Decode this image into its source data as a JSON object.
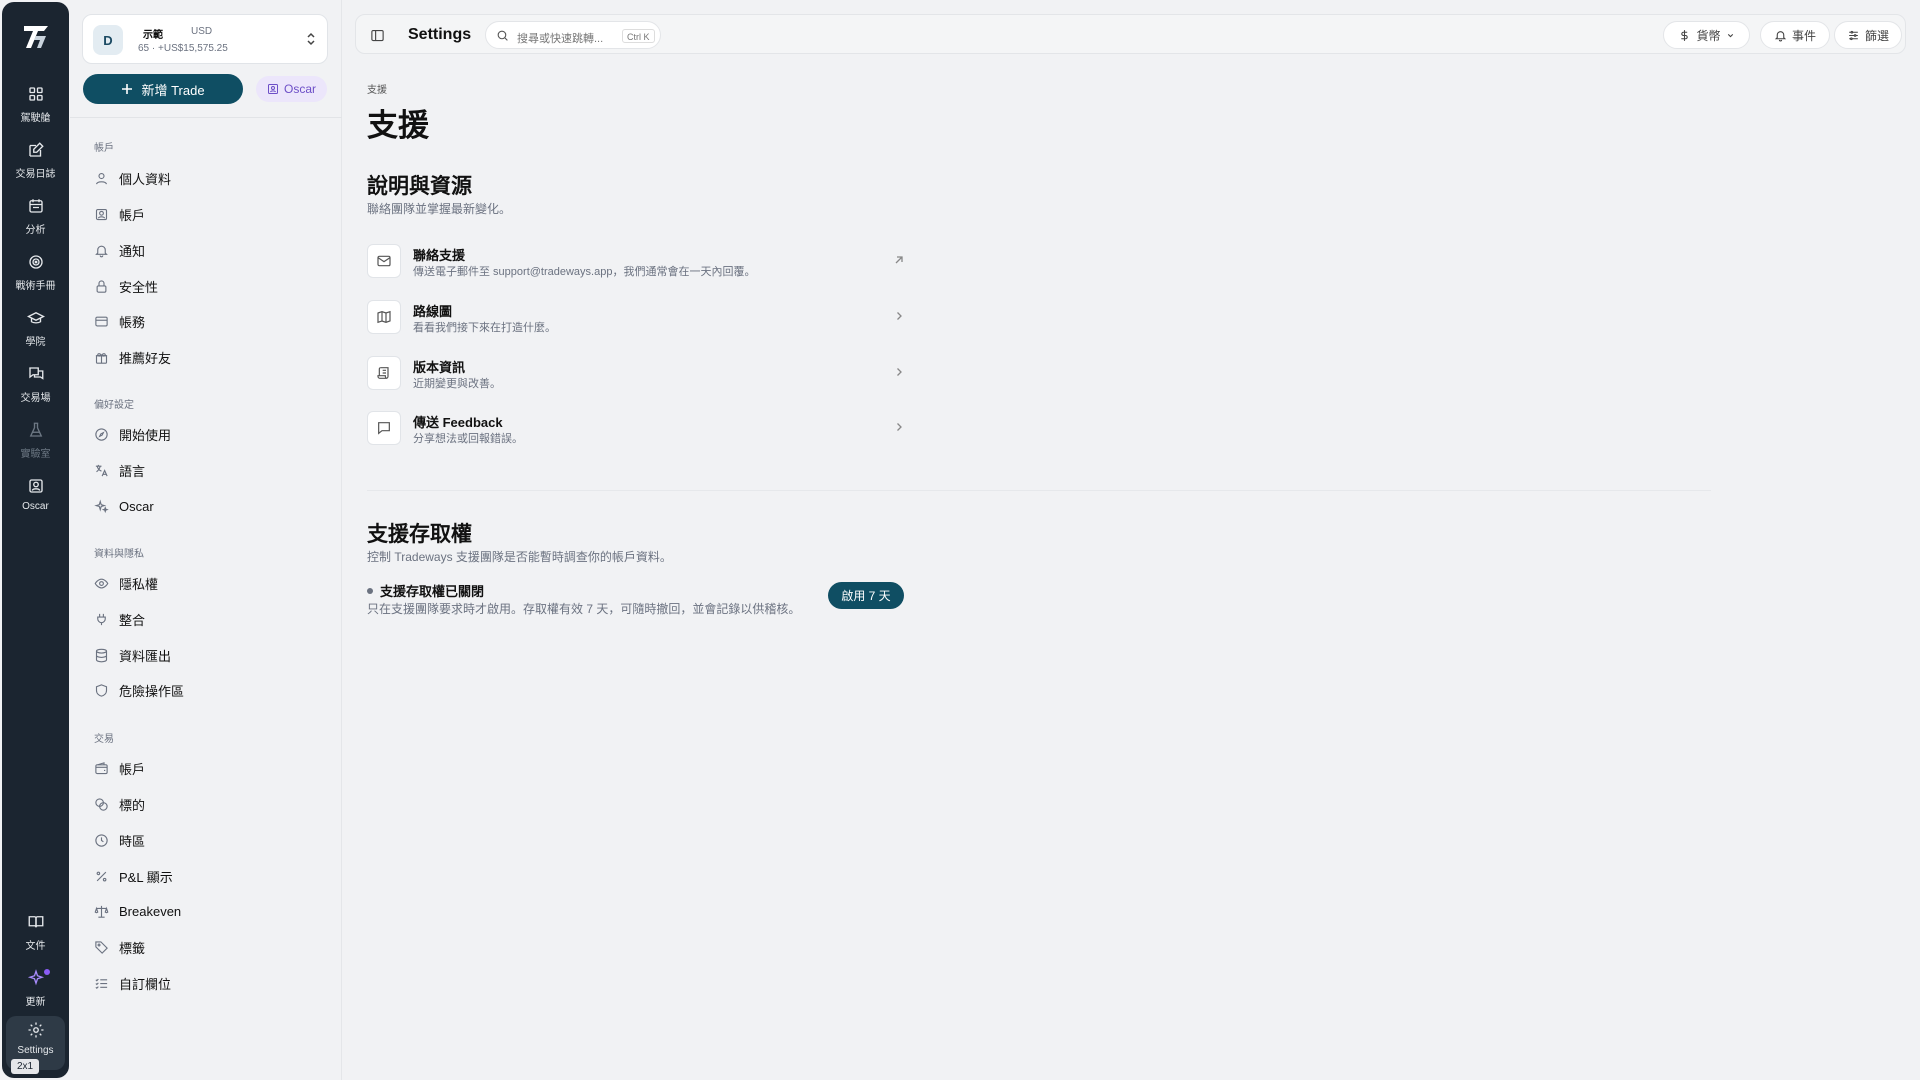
{
  "rail": {
    "items": [
      {
        "label": "駕駛艙",
        "icon": "dashboard-icon"
      },
      {
        "label": "交易日誌",
        "icon": "journal-icon"
      },
      {
        "label": "分析",
        "icon": "calendar-icon"
      },
      {
        "label": "戰術手冊",
        "icon": "target-icon"
      },
      {
        "label": "學院",
        "icon": "graduation-cap-icon"
      },
      {
        "label": "交易場",
        "icon": "chat-icon"
      },
      {
        "label": "實驗室",
        "icon": "flask-icon"
      },
      {
        "label": "Oscar",
        "icon": "oscar-icon"
      },
      {
        "label": "文件",
        "icon": "book-icon"
      },
      {
        "label": "更新",
        "icon": "sparkle-icon"
      },
      {
        "label": "Settings",
        "icon": "gear-icon"
      }
    ],
    "badge": "2x1"
  },
  "account": {
    "avatar": "D",
    "name": "示範",
    "currency": "USD",
    "balance": "65 · +US$15,575.25"
  },
  "sidebar": {
    "new_trade": "新增 Trade",
    "oscar": "Oscar",
    "sections": [
      {
        "title": "帳戶",
        "items": [
          "個人資料",
          "帳戶",
          "通知",
          "安全性",
          "帳務",
          "推薦好友"
        ]
      },
      {
        "title": "偏好設定",
        "items": [
          "開始使用",
          "語言",
          "Oscar"
        ]
      },
      {
        "title": "資料與隱私",
        "items": [
          "隱私權",
          "整合",
          "資料匯出",
          "危險操作區"
        ]
      },
      {
        "title": "交易",
        "items": [
          "帳戶",
          "標的",
          "時區",
          "P&L 顯示",
          "Breakeven",
          "標籤",
          "自訂欄位"
        ]
      }
    ]
  },
  "topbar": {
    "title": "Settings",
    "search_placeholder": "搜尋或快速跳轉...",
    "search_shortcut": "Ctrl K",
    "currency": "貨幣",
    "events": "事件",
    "filter": "篩選"
  },
  "page": {
    "breadcrumb": "支援",
    "title": "支援",
    "help": {
      "title": "說明與資源",
      "subtitle": "聯絡團隊並掌握最新變化。",
      "rows": [
        {
          "title": "聯絡支援",
          "desc": "傳送電子郵件至 support@tradeways.app，我們通常會在一天內回覆。"
        },
        {
          "title": "路線圖",
          "desc": "看看我們接下來在打造什麼。"
        },
        {
          "title": "版本資訊",
          "desc": "近期變更與改善。"
        },
        {
          "title": "傳送 Feedback",
          "desc": "分享想法或回報錯誤。"
        }
      ]
    },
    "access": {
      "title": "支援存取權",
      "subtitle": "控制 Tradeways 支援團隊是否能暫時調查你的帳戶資料。",
      "status": "支援存取權已關閉",
      "desc": "只在支援團隊要求時才啟用。存取權有效 7 天，可隨時撤回，並會記錄以供稽核。",
      "button": "啟用 7 天"
    }
  }
}
